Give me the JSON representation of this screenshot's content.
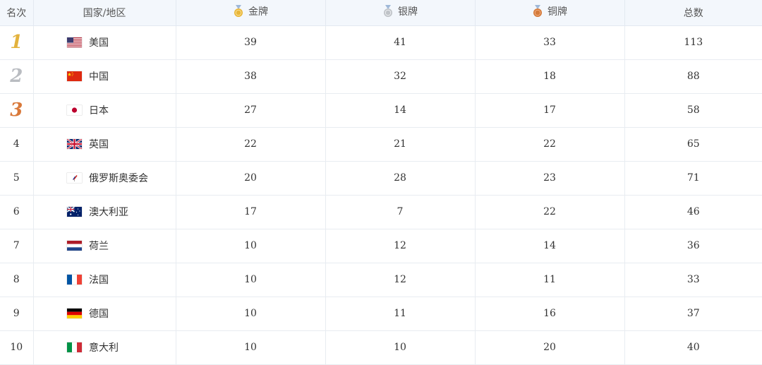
{
  "header": {
    "rank": "名次",
    "country": "国家/地区",
    "gold": "金牌",
    "silver": "银牌",
    "bronze": "铜牌",
    "total": "总数"
  },
  "colors": {
    "header_bg": "#f3f7fc",
    "gold": "#e8b63a",
    "silver": "#bfc3c8",
    "bronze": "#d47a3a"
  },
  "rows": [
    {
      "rank": "1",
      "flag": "us-flag",
      "country": "美国",
      "gold": "39",
      "silver": "41",
      "bronze": "33",
      "total": "113"
    },
    {
      "rank": "2",
      "flag": "cn-flag",
      "country": "中国",
      "gold": "38",
      "silver": "32",
      "bronze": "18",
      "total": "88"
    },
    {
      "rank": "3",
      "flag": "jp-flag",
      "country": "日本",
      "gold": "27",
      "silver": "14",
      "bronze": "17",
      "total": "58"
    },
    {
      "rank": "4",
      "flag": "gb-flag",
      "country": "英国",
      "gold": "22",
      "silver": "21",
      "bronze": "22",
      "total": "65"
    },
    {
      "rank": "5",
      "flag": "roc-flag",
      "country": "俄罗斯奥委会",
      "gold": "20",
      "silver": "28",
      "bronze": "23",
      "total": "71"
    },
    {
      "rank": "6",
      "flag": "au-flag",
      "country": "澳大利亚",
      "gold": "17",
      "silver": "7",
      "bronze": "22",
      "total": "46"
    },
    {
      "rank": "7",
      "flag": "nl-flag",
      "country": "荷兰",
      "gold": "10",
      "silver": "12",
      "bronze": "14",
      "total": "36"
    },
    {
      "rank": "8",
      "flag": "fr-flag",
      "country": "法国",
      "gold": "10",
      "silver": "12",
      "bronze": "11",
      "total": "33"
    },
    {
      "rank": "9",
      "flag": "de-flag",
      "country": "德国",
      "gold": "10",
      "silver": "11",
      "bronze": "16",
      "total": "37"
    },
    {
      "rank": "10",
      "flag": "it-flag",
      "country": "意大利",
      "gold": "10",
      "silver": "10",
      "bronze": "20",
      "total": "40"
    }
  ]
}
